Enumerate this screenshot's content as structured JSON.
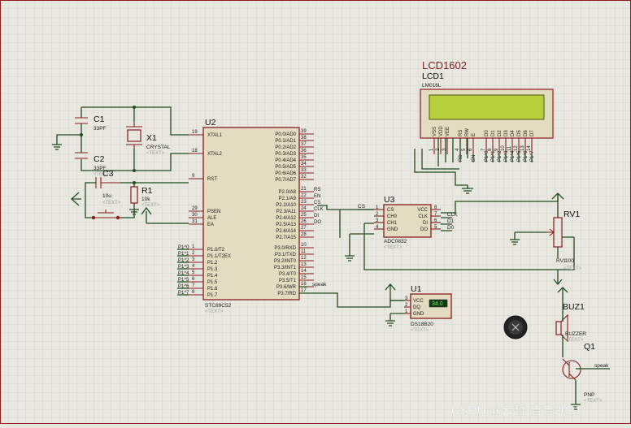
{
  "watermark": "CSDN @云哲-吉吉2021",
  "text_placeholder": "<TEXT>",
  "c1": {
    "ref": "C1",
    "value": "33PF"
  },
  "c2": {
    "ref": "C2",
    "value": "33PF"
  },
  "c3": {
    "ref": "C3",
    "value": "10u"
  },
  "r1": {
    "ref": "R1",
    "value": "10k"
  },
  "x1": {
    "ref": "X1",
    "value": "CRYSTAL"
  },
  "u2": {
    "ref": "U2",
    "part": "STC89C52",
    "left_pins": [
      {
        "num": "19",
        "name": "XTAL1"
      },
      {
        "num": "18",
        "name": "XTAL2"
      },
      {
        "num": "9",
        "name": "RST"
      },
      {
        "num": "29",
        "name": "PSEN"
      },
      {
        "num": "30",
        "name": "ALE"
      },
      {
        "num": "31",
        "name": "EA"
      },
      {
        "num": "1",
        "name": "P1.0/T2"
      },
      {
        "num": "2",
        "name": "P1.1/T2EX"
      },
      {
        "num": "3",
        "name": "P1.2"
      },
      {
        "num": "4",
        "name": "P1.3"
      },
      {
        "num": "5",
        "name": "P1.4"
      },
      {
        "num": "6",
        "name": "P1.5"
      },
      {
        "num": "7",
        "name": "P1.6"
      },
      {
        "num": "8",
        "name": "P1.7"
      }
    ],
    "right_pins": [
      {
        "num": "39",
        "name": "P0.0/AD0"
      },
      {
        "num": "38",
        "name": "P0.1/AD1"
      },
      {
        "num": "37",
        "name": "P0.2/AD2"
      },
      {
        "num": "36",
        "name": "P0.3/AD3"
      },
      {
        "num": "35",
        "name": "P0.4/AD4"
      },
      {
        "num": "34",
        "name": "P0.5/AD5"
      },
      {
        "num": "33",
        "name": "P0.6/AD6"
      },
      {
        "num": "32",
        "name": "P0.7/AD7"
      },
      {
        "num": "21",
        "name": "P2.0/A8"
      },
      {
        "num": "22",
        "name": "P2.1/A9"
      },
      {
        "num": "23",
        "name": "P2.2/A10"
      },
      {
        "num": "24",
        "name": "P2.3/A11"
      },
      {
        "num": "25",
        "name": "P2.4/A12"
      },
      {
        "num": "26",
        "name": "P2.5/A13"
      },
      {
        "num": "27",
        "name": "P2.6/A14"
      },
      {
        "num": "28",
        "name": "P2.7/A15"
      },
      {
        "num": "10",
        "name": "P3.0/RXD"
      },
      {
        "num": "11",
        "name": "P3.1/TXD"
      },
      {
        "num": "12",
        "name": "P3.2/INT0"
      },
      {
        "num": "13",
        "name": "P3.3/INT1"
      },
      {
        "num": "14",
        "name": "P3.4/T0"
      },
      {
        "num": "15",
        "name": "P3.5/T1"
      },
      {
        "num": "16",
        "name": "P3.6/WR"
      },
      {
        "num": "17",
        "name": "P3.7/RD"
      }
    ],
    "p2_nets": [
      "RS",
      "EN",
      "CS",
      "CLK",
      "DI",
      "DO"
    ],
    "p1_nets": [
      "P1^0",
      "P1^1",
      "P1^2",
      "P1^3",
      "P1^4",
      "P1^5",
      "P1^6",
      "P1^7"
    ],
    "speak_net": "speak"
  },
  "lcd": {
    "title": "LCD1602",
    "ref": "LCD1",
    "part": "LM016L",
    "pins": [
      "VSS",
      "VDD",
      "VEE",
      "RS",
      "RW",
      "E",
      "D0",
      "D1",
      "D2",
      "D3",
      "D4",
      "D5",
      "D6",
      "D7"
    ],
    "nets": [
      "RS",
      "EN",
      "P1^0",
      "P1^1",
      "P1^2",
      "P1^3",
      "P1^4",
      "P1^5",
      "P1^6",
      "P1^7"
    ],
    "color": "#b8cf3c"
  },
  "u3": {
    "ref": "U3",
    "part": "ADC0832",
    "left_pins": [
      {
        "num": "1",
        "name": "CS"
      },
      {
        "num": "2",
        "name": "CH0"
      },
      {
        "num": "3",
        "name": "CH1"
      },
      {
        "num": "4",
        "name": "GND"
      }
    ],
    "right_pins": [
      {
        "num": "8",
        "name": "VCC"
      },
      {
        "num": "7",
        "name": "CLK"
      },
      {
        "num": "6",
        "name": "DI"
      },
      {
        "num": "5",
        "name": "DO"
      }
    ],
    "nets": {
      "cs": "CS",
      "clk": "CLK",
      "di": "D1",
      "do": "D0"
    }
  },
  "u1": {
    "ref": "U1",
    "part": "DS18B20",
    "display": "34.0",
    "pins": [
      {
        "num": "3",
        "name": "VCC"
      },
      {
        "num": "2",
        "name": "DQ"
      },
      {
        "num": "1",
        "name": "GND"
      }
    ]
  },
  "rv1": {
    "ref": "RV1",
    "value": "RV1",
    "percent": "100"
  },
  "buz1": {
    "ref": "BUZ1",
    "part": "BUZZER"
  },
  "q1": {
    "ref": "Q1",
    "part": "PNP",
    "net": "speak"
  },
  "colors": {
    "background": "#e8e8e0",
    "grid": "#c9c9c0",
    "wire": "#1f4d1f",
    "component": "#8a1c1c",
    "body": "#e4dcc0"
  }
}
